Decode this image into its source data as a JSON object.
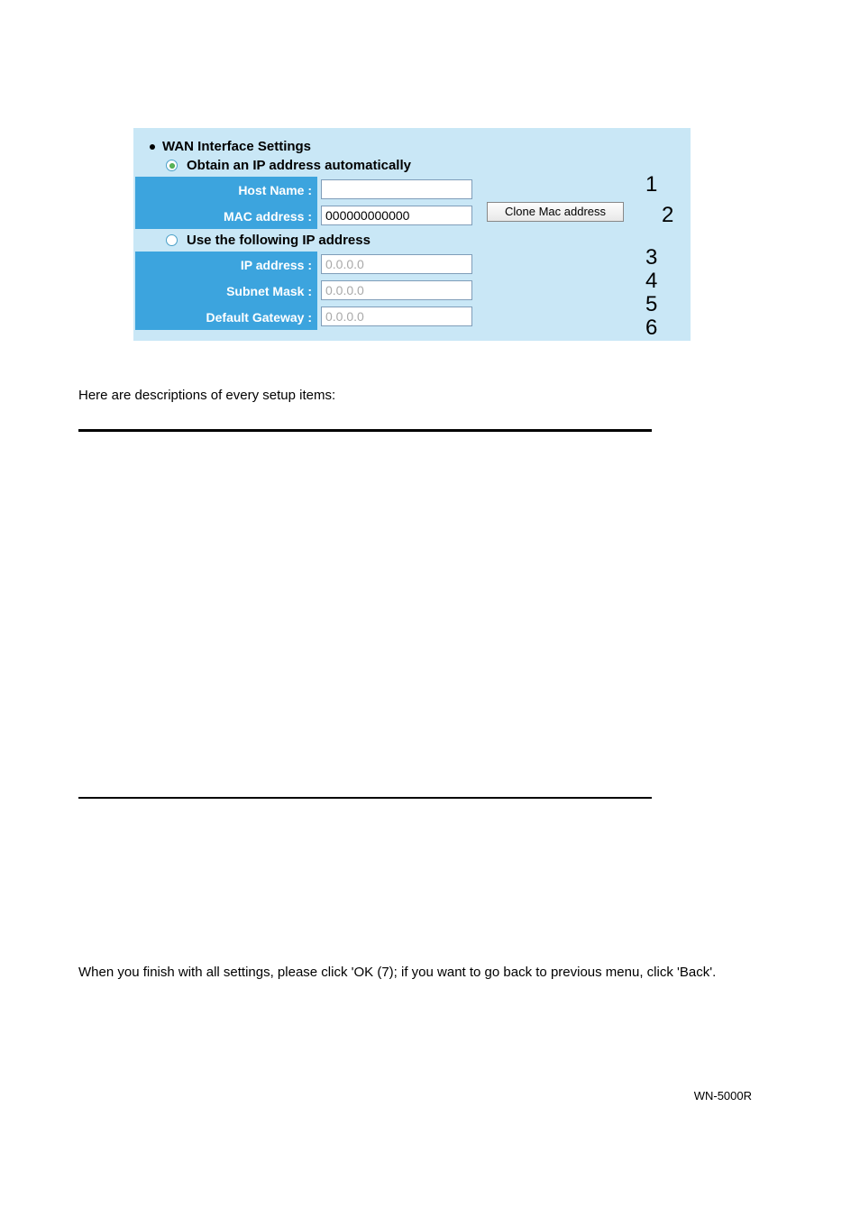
{
  "panel": {
    "section_title": "WAN Interface Settings",
    "radio_auto_label": "Obtain an IP address automatically",
    "radio_manual_label": "Use the following IP address",
    "host_name_label": "Host Name :",
    "host_name_value": "",
    "mac_label": "MAC address :",
    "mac_value": "000000000000",
    "clone_button": "Clone Mac address",
    "ip_label": "IP address :",
    "ip_value": "0.0.0.0",
    "subnet_label": "Subnet Mask :",
    "subnet_value": "0.0.0.0",
    "gateway_label": "Default Gateway :",
    "gateway_value": "0.0.0.0"
  },
  "callouts": {
    "n1": "1",
    "n2": "2",
    "n3": "3",
    "n4": "4",
    "n5": "5",
    "n6": "6"
  },
  "body": {
    "desc_intro": "Here are descriptions of every setup items:",
    "finish_text": "When you finish with all settings, please click 'OK (7); if you want to go back to previous menu, click 'Back'.",
    "footer": "WN-5000R"
  }
}
